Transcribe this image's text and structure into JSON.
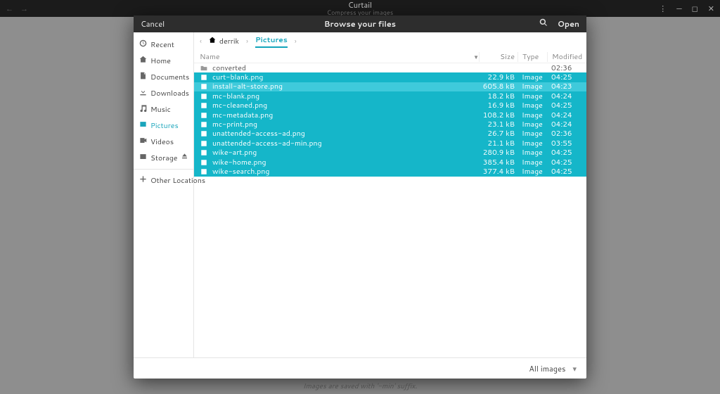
{
  "titlebar": {
    "title": "Curtail",
    "subtitle": "Compress your images"
  },
  "dialog": {
    "cancel": "Cancel",
    "title": "Browse your files",
    "open": "Open"
  },
  "sidebar": {
    "items": [
      {
        "label": "Recent",
        "icon": "clock-icon"
      },
      {
        "label": "Home",
        "icon": "home-icon"
      },
      {
        "label": "Documents",
        "icon": "documents-icon"
      },
      {
        "label": "Downloads",
        "icon": "download-icon"
      },
      {
        "label": "Music",
        "icon": "music-icon"
      },
      {
        "label": "Pictures",
        "icon": "pictures-icon",
        "active": true
      },
      {
        "label": "Videos",
        "icon": "video-icon"
      },
      {
        "label": "Storage",
        "icon": "disk-icon",
        "eject": true
      }
    ],
    "other": "Other Locations"
  },
  "pathbar": {
    "segments": [
      {
        "label": "derrik",
        "home": true
      },
      {
        "label": "Pictures",
        "active": true
      }
    ]
  },
  "columns": {
    "name": "Name",
    "size": "Size",
    "type": "Type",
    "modified": "Modified"
  },
  "rows": [
    {
      "kind": "folder",
      "name": "converted",
      "size": "",
      "type": "",
      "modified": "02:36",
      "sel": false
    },
    {
      "kind": "file",
      "name": "curt-blank.png",
      "size": "22.9 kB",
      "type": "Image",
      "modified": "04:25",
      "sel": true
    },
    {
      "kind": "file",
      "name": "install-alt-store.png",
      "size": "605.8 kB",
      "type": "Image",
      "modified": "04:23",
      "sel": true,
      "focus": true
    },
    {
      "kind": "file",
      "name": "mc-blank.png",
      "size": "18.2 kB",
      "type": "Image",
      "modified": "04:24",
      "sel": true
    },
    {
      "kind": "file",
      "name": "mc-cleaned.png",
      "size": "16.9 kB",
      "type": "Image",
      "modified": "04:25",
      "sel": true
    },
    {
      "kind": "file",
      "name": "mc-metadata.png",
      "size": "108.2 kB",
      "type": "Image",
      "modified": "04:24",
      "sel": true
    },
    {
      "kind": "file",
      "name": "mc-print.png",
      "size": "23.1 kB",
      "type": "Image",
      "modified": "04:24",
      "sel": true
    },
    {
      "kind": "file",
      "name": "unattended-access-ad.png",
      "size": "26.7 kB",
      "type": "Image",
      "modified": "02:36",
      "sel": true
    },
    {
      "kind": "file",
      "name": "unattended-access-ad-min.png",
      "size": "21.1 kB",
      "type": "Image",
      "modified": "03:55",
      "sel": true
    },
    {
      "kind": "file",
      "name": "wike-art.png",
      "size": "280.9 kB",
      "type": "Image",
      "modified": "04:25",
      "sel": true
    },
    {
      "kind": "file",
      "name": "wike-home.png",
      "size": "385.4 kB",
      "type": "Image",
      "modified": "04:25",
      "sel": true
    },
    {
      "kind": "file",
      "name": "wike-search.png",
      "size": "377.4 kB",
      "type": "Image",
      "modified": "04:25",
      "sel": true
    }
  ],
  "footer": {
    "filter": "All images"
  },
  "hint": "Images are saved with '-min' suffix."
}
